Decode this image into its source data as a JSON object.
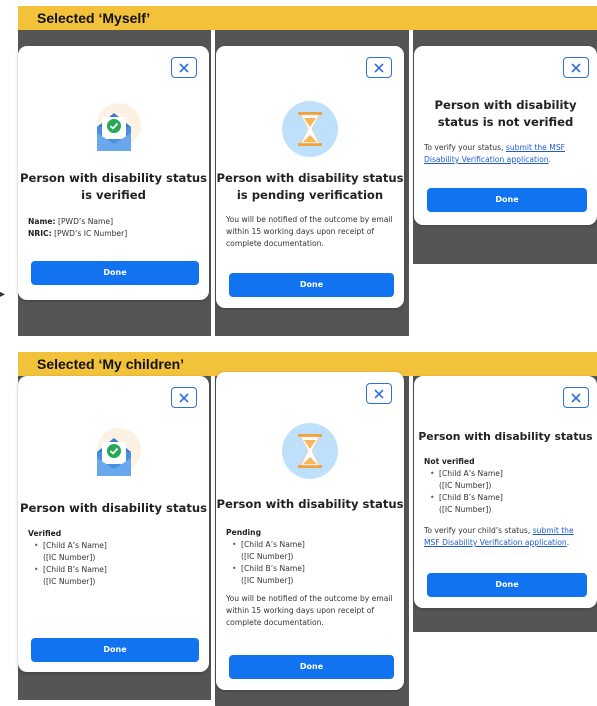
{
  "section1": {
    "banner": "Selected ‘Myself’",
    "verified": {
      "title": "Person with disability status is verified",
      "name_label": "Name:",
      "name_value": "[PWD’s Name]",
      "nric_label": "NRIC:",
      "nric_value": "[PWD’s IC Number]",
      "button": "Done"
    },
    "pending": {
      "title": "Person with disability status is pending verification",
      "body": "You will be notified of the outcome by email within 15 working days upon receipt of complete documentation.",
      "button": "Done"
    },
    "not_verified": {
      "title": "Person with disability status is not verified",
      "body_prefix": "To verify your status, ",
      "link": "submit the MSF Disability Verification application",
      "body_suffix": ".",
      "button": "Done"
    }
  },
  "section2": {
    "banner": "Selected ‘My children’",
    "verified": {
      "title": "Person with disability status",
      "status": "Verified",
      "children": [
        {
          "name": "[Child A’s Name]",
          "ic": "([IC Number])"
        },
        {
          "name": "[Child B’s Name]",
          "ic": "([IC Number])"
        }
      ],
      "button": "Done"
    },
    "pending": {
      "title": "Person with disability status",
      "status": "Pending",
      "children": [
        {
          "name": "[Child A’s Name]",
          "ic": "([IC Number])"
        },
        {
          "name": "[Child B’s Name]",
          "ic": "([IC Number])"
        }
      ],
      "body": "You will be notified of the outcome by email within 15 working days upon receipt of complete documentation.",
      "button": "Done"
    },
    "not_verified": {
      "title": "Person with disability status",
      "status": "Not verified",
      "children": [
        {
          "name": "[Child A’s Name]",
          "ic": "([IC Number])"
        },
        {
          "name": "[Child B’s Name]",
          "ic": "([IC Number])"
        }
      ],
      "body_prefix": "To verify your child’s status, ",
      "link": "submit the MSF Disability Verification application",
      "body_suffix": ".",
      "button": "Done"
    }
  },
  "icons": {
    "close": "close-icon",
    "envelope": "envelope-check-icon",
    "hourglass": "hourglass-icon",
    "arrow": "arrow-right-icon"
  },
  "colors": {
    "banner": "#f2c23b",
    "primary": "#1173f0",
    "phone_bg": "#555555",
    "link": "#1f5bd4"
  }
}
